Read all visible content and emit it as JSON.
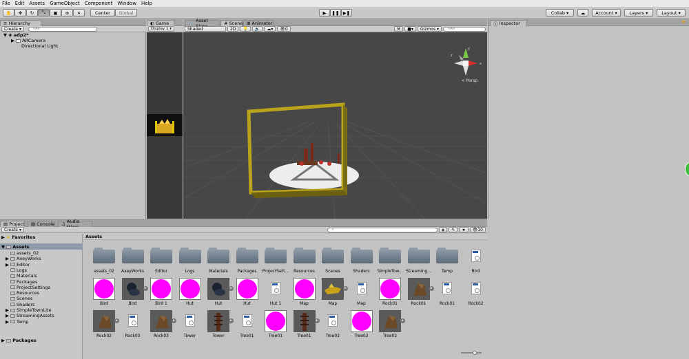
{
  "menu": [
    "File",
    "Edit",
    "Assets",
    "GameObject",
    "Component",
    "Window",
    "Help"
  ],
  "toolbar": {
    "pivot_label": "Center",
    "space_label": "Global",
    "collab_label": "Collab",
    "account_label": "Account",
    "layers_label": "Layers",
    "layout_label": "Layout"
  },
  "hierarchy": {
    "tab": "Hierarchy",
    "create_label": "Create",
    "search_placeholder": "All",
    "scene_name": "adp2*",
    "items": [
      "ARCamera",
      "Directional Light"
    ]
  },
  "game": {
    "tab": "Game",
    "display_label": "Display 1"
  },
  "scene": {
    "tabs": [
      "Asset Store",
      "Scene",
      "Animator"
    ],
    "shading_label": "Shaded",
    "mode_2d": "2D",
    "fx_count": "0",
    "gizmos_label": "Gizmos",
    "search_placeholder": "All",
    "persp_label": "Persp",
    "axis_y": "y",
    "axis_x": "x",
    "axis_z": "z"
  },
  "inspector": {
    "tab": "Inspector"
  },
  "project": {
    "tabs": [
      "Project",
      "Console",
      "Audio Mixer"
    ],
    "create_label": "Create",
    "count": "10",
    "favorites_label": "Favorites",
    "assets_label": "Assets",
    "packages_label": "Packages",
    "breadcrumb": "Assets",
    "tree": [
      "assets_02",
      "AxeyWorks",
      "Editor",
      "Logs",
      "Materials",
      "Packages",
      "ProjectSettings",
      "Resources",
      "Scenes",
      "Shaders",
      "SimpleTownLite",
      "StreamingAssets",
      "Temp"
    ],
    "row1": [
      "assets_02",
      "AxeyWorks",
      "Editor",
      "Logs",
      "Materials",
      "Packages",
      "ProjectSett...",
      "Resources",
      "Scenes",
      "Shaders",
      "SimpleTow...",
      "Streaming...",
      "Temp",
      "Bird"
    ],
    "row2": [
      "Bird",
      "Bird",
      "Bird 1",
      "Hut",
      "Hut",
      "Hut",
      "Hut 1",
      "Map",
      "Map",
      "Map",
      "Rock01",
      "Rock01",
      "Rock01",
      "Rock02"
    ],
    "row3": [
      "Rock02",
      "Rock03",
      "Rock03",
      "Tower",
      "Tower",
      "Tree01",
      "Tree01",
      "Tree01",
      "Tree02",
      "Tree02",
      "Tree02"
    ]
  }
}
